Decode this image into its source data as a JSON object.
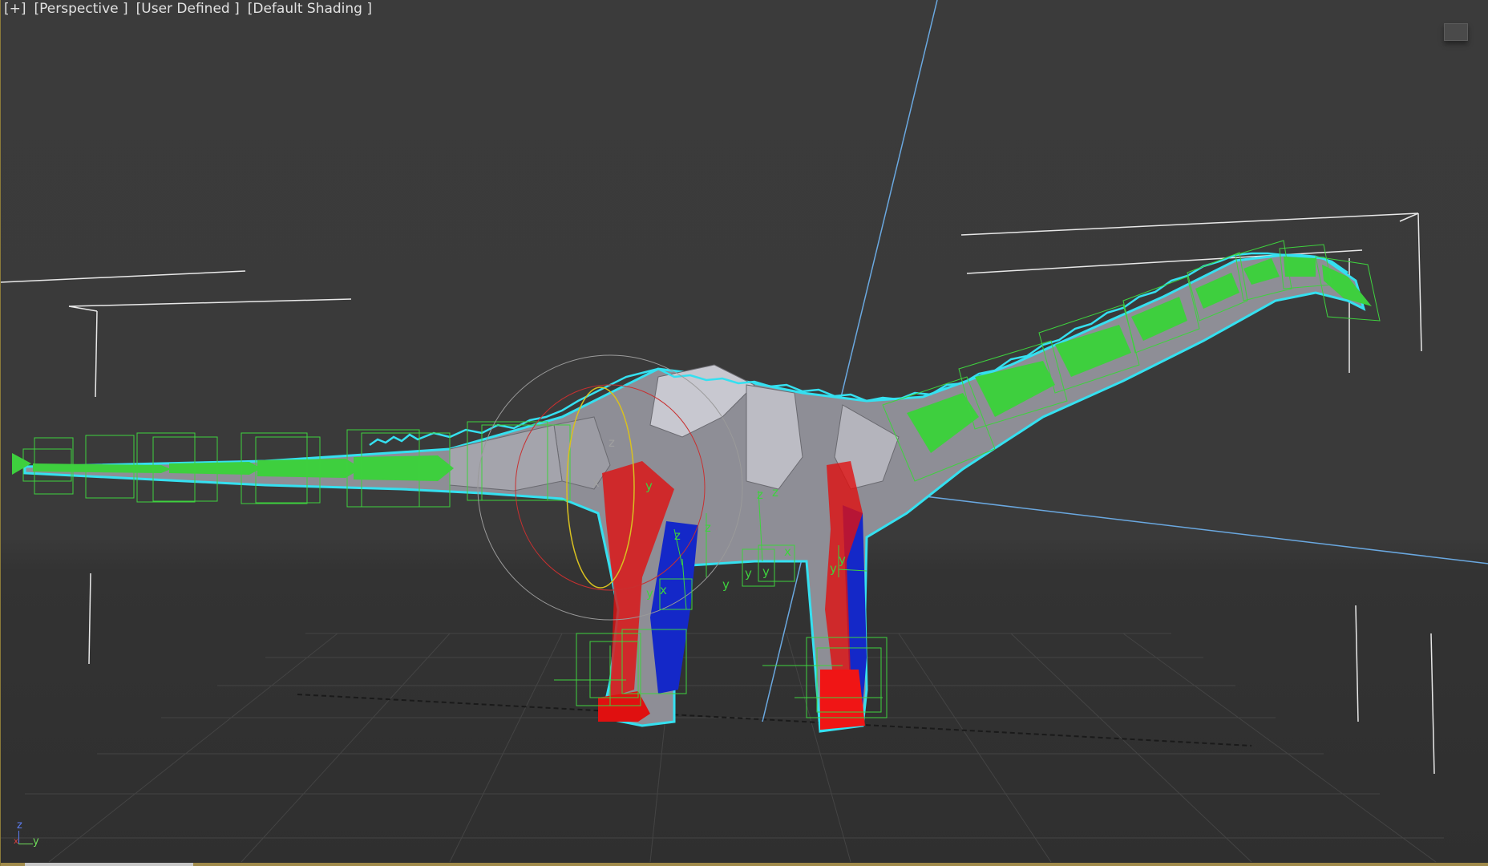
{
  "viewport": {
    "labels": [
      "[+]",
      "[Perspective ]",
      "[User Defined ]",
      "[Default Shading ]"
    ]
  },
  "axis_tripod": {
    "z": "z",
    "y": "y",
    "x": "x"
  },
  "gizmo_labels": [
    "z",
    "y",
    "x",
    "y",
    "z",
    "z",
    "z",
    "y",
    "x",
    "y",
    "x",
    "y",
    "y",
    "y",
    "z"
  ],
  "colors": {
    "background": "#3b3b3b",
    "selection_outline": "#35e0f0",
    "bone_green": "#3ecf3e",
    "bone_wire": "#3ed23e",
    "leg_red": "#e01010",
    "leg_blue": "#1428c8",
    "body_grey": "#a8a8b0",
    "axis_line": "#6aa8e0"
  }
}
